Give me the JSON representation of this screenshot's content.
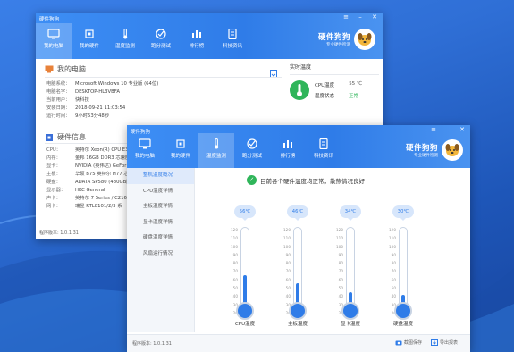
{
  "colors": {
    "accent": "#2f7ce8",
    "ok": "#2fb55a",
    "desktop": "#2f6fd6"
  },
  "winA": {
    "title": "硬件狗狗",
    "nav": [
      {
        "label": "我的电脑",
        "icon": "monitor-icon"
      },
      {
        "label": "我的硬件",
        "icon": "chip-icon"
      },
      {
        "label": "温度监测",
        "icon": "thermometer-icon"
      },
      {
        "label": "跑分测试",
        "icon": "gauge-icon"
      },
      {
        "label": "排行榜",
        "icon": "bar-chart-icon"
      },
      {
        "label": "科技资讯",
        "icon": "document-icon"
      }
    ],
    "brand_name": "硬件狗狗",
    "brand_slogan": "专业硬件检测",
    "section1": "我的电脑",
    "sysinfo": [
      {
        "k": "电脑系统：",
        "v": "Microsoft Windows 10 专业版 (64位)"
      },
      {
        "k": "电脑名字：",
        "v": "DESKTOP-HL3VBFA"
      },
      {
        "k": "当前用户：",
        "v": "快科技"
      },
      {
        "k": "安装日期：",
        "v": "2018-09-21 11:03:54"
      },
      {
        "k": "运行时间：",
        "v": "9小时53分48秒"
      }
    ],
    "section2": "硬件信息",
    "hwinfo": [
      {
        "k": "CPU：",
        "v": "英特尔 Xeon(R) CPU E3-1"
      },
      {
        "k": "内存：",
        "v": "金邦 16GB DDR3  芯速度"
      },
      {
        "k": "显卡：",
        "v": "NVIDIA (英伟达) GeFor"
      },
      {
        "k": "主板：",
        "v": "华硕 B75 英特尔 H77 芯"
      },
      {
        "k": "硬盘：",
        "v": "ADATA SP580 (480GB固"
      },
      {
        "k": "显示器：",
        "v": "HKC General"
      },
      {
        "k": "声卡：",
        "v": "英特尔 7 Series / C216"
      },
      {
        "k": "网卡：",
        "v": "瑞昱 RTL8101/2/3 系"
      }
    ],
    "realtime_title": "实时温度",
    "cpu_temp_label": "CPU温度",
    "cpu_temp_value": "55 ℃",
    "temp_state_label": "温度状态",
    "temp_state_value": "正常",
    "version": "程序版本: 1.0.1.31"
  },
  "winB": {
    "title": "硬件狗狗",
    "nav": [
      {
        "label": "我的电脑",
        "icon": "monitor-icon"
      },
      {
        "label": "我的硬件",
        "icon": "chip-icon"
      },
      {
        "label": "温度监测",
        "icon": "thermometer-icon"
      },
      {
        "label": "跑分测试",
        "icon": "gauge-icon"
      },
      {
        "label": "排行榜",
        "icon": "bar-chart-icon"
      },
      {
        "label": "科技资讯",
        "icon": "document-icon"
      }
    ],
    "brand_name": "硬件狗狗",
    "brand_slogan": "专业硬件检测",
    "sidebar": [
      "整机温度概况",
      "CPU温度详情",
      "主板温度详情",
      "显卡温度详情",
      "硬盘温度详情",
      "风扇运行情况"
    ],
    "notice": "目前各个硬件温度均正常，散热情况良好",
    "scale": [
      "120",
      "110",
      "100",
      "90",
      "80",
      "70",
      "60",
      "50",
      "40",
      "30",
      "20"
    ],
    "thermometers": [
      {
        "label": "CPU温度",
        "value": "56℃",
        "level": 56
      },
      {
        "label": "主板温度",
        "value": "46℃",
        "level": 46
      },
      {
        "label": "显卡温度",
        "value": "34℃",
        "level": 34
      },
      {
        "label": "硬盘温度",
        "value": "30℃",
        "level": 30
      }
    ],
    "version": "程序版本: 1.0.1.31",
    "screenshot_label": "截图保存",
    "export_label": "导出报表"
  }
}
